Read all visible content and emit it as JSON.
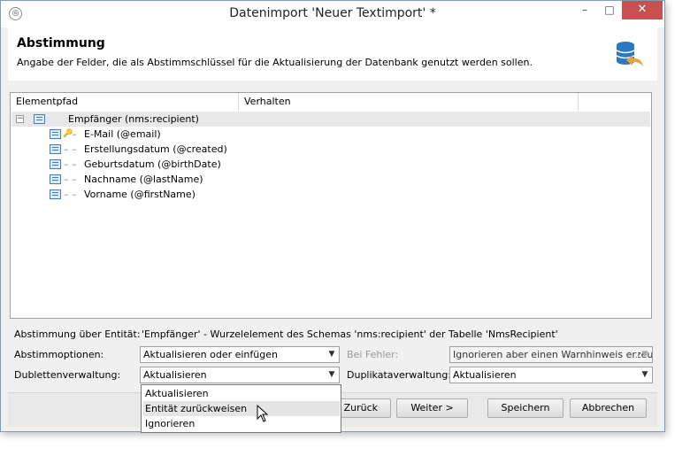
{
  "window": {
    "title": "Datenimport 'Neuer Textimport' *",
    "minimize_symbol": "–",
    "maximize_symbol": "□",
    "close_symbol": "✕"
  },
  "header": {
    "title": "Abstimmung",
    "subtitle": "Angabe der Felder, die als Abstimmschlüssel für die Aktualisierung der Datenbank genutzt werden sollen."
  },
  "tree": {
    "columns": [
      "Elementpfad",
      "Verhalten"
    ],
    "root": {
      "label": "Empfänger (nms:recipient)",
      "expanded": true
    },
    "items": [
      {
        "label": "E-Mail (@email)",
        "is_key": true
      },
      {
        "label": "Erstellungsdatum (@created)",
        "is_key": false
      },
      {
        "label": "Geburtsdatum (@birthDate)",
        "is_key": false
      },
      {
        "label": "Nachname (@lastName)",
        "is_key": false
      },
      {
        "label": "Vorname (@firstName)",
        "is_key": false
      }
    ]
  },
  "form": {
    "entity_label": "Abstimmung über Entität:",
    "entity_value": "'Empfänger' - Wurzelelement des Schemas 'nms:recipient' der Tabelle 'NmsRecipient'",
    "options_label": "Abstimmoptionen:",
    "options_value": "Aktualisieren oder einfügen",
    "error_label": "Bei Fehler:",
    "error_value": "Ignorieren aber einen Warnhinweis erzeugen",
    "duplicates_label": "Dublettenverwaltung:",
    "duplicates_value": "Aktualisieren",
    "duplicate_mgmt_label": "Duplikataverwaltung:",
    "duplicate_mgmt_value": "Aktualisieren"
  },
  "dropdown": {
    "options": [
      "Aktualisieren",
      "Entität zurückweisen",
      "Ignorieren"
    ],
    "hovered_index": 1
  },
  "buttons": {
    "back": "< Zurück",
    "next": "Weiter >",
    "save": "Speichern",
    "cancel": "Abbrechen"
  },
  "icons": {
    "header_icon": "database-refresh-icon",
    "key_icon": "key-icon",
    "attribute_icon": "list-icon"
  },
  "colors": {
    "close_button": "#c75050",
    "database_icon": "#2b78c2",
    "refresh_arrow": "#e8a33c"
  }
}
